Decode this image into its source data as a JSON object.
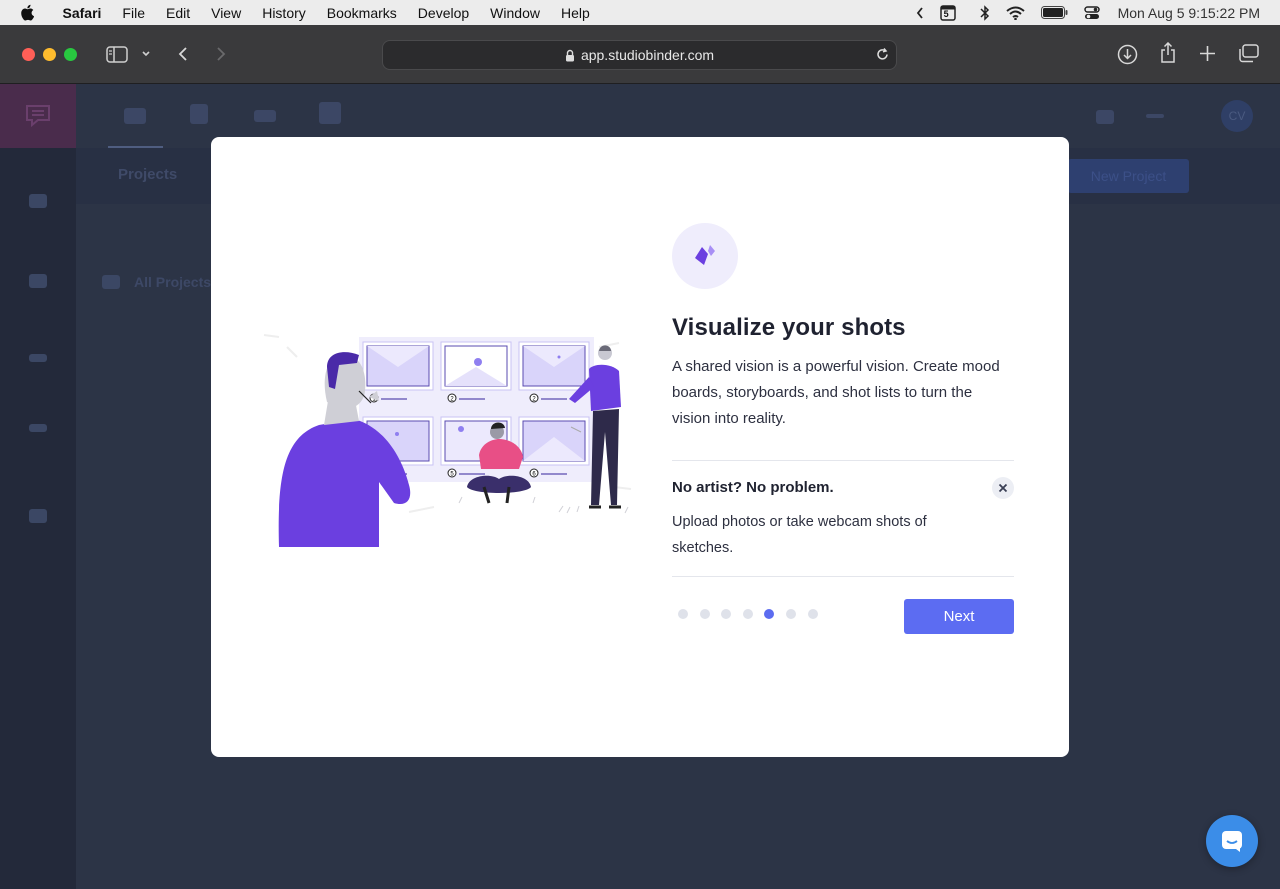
{
  "menubar": {
    "app_name": "Safari",
    "items": [
      "File",
      "Edit",
      "View",
      "History",
      "Bookmarks",
      "Develop",
      "Window",
      "Help"
    ],
    "calendar_day": "5",
    "clock": "Mon Aug 5  9:15:22 PM"
  },
  "browser": {
    "url": "app.studiobinder.com"
  },
  "background_app": {
    "section_title": "Projects",
    "new_project_label": "New Project",
    "all_projects_label": "All Projects",
    "avatar_initials": "CV"
  },
  "modal": {
    "title": "Visualize your shots",
    "description": "A shared vision is a powerful vision. Create mood boards, storyboards, and shot lists to turn the vision into reality.",
    "tip": {
      "title": "No artist? No problem.",
      "text": "Upload photos or take webcam shots of sketches."
    },
    "pagination": {
      "total": 7,
      "current": 5
    },
    "next_label": "Next",
    "storyboard_frame_numbers": [
      "1",
      "2",
      "2",
      "5",
      "6"
    ]
  },
  "colors": {
    "accent": "#5c6cf2",
    "badge_bg": "#efedfc",
    "illustration_purple": "#6b3fe0",
    "overlay_bg": "#2c3446"
  }
}
